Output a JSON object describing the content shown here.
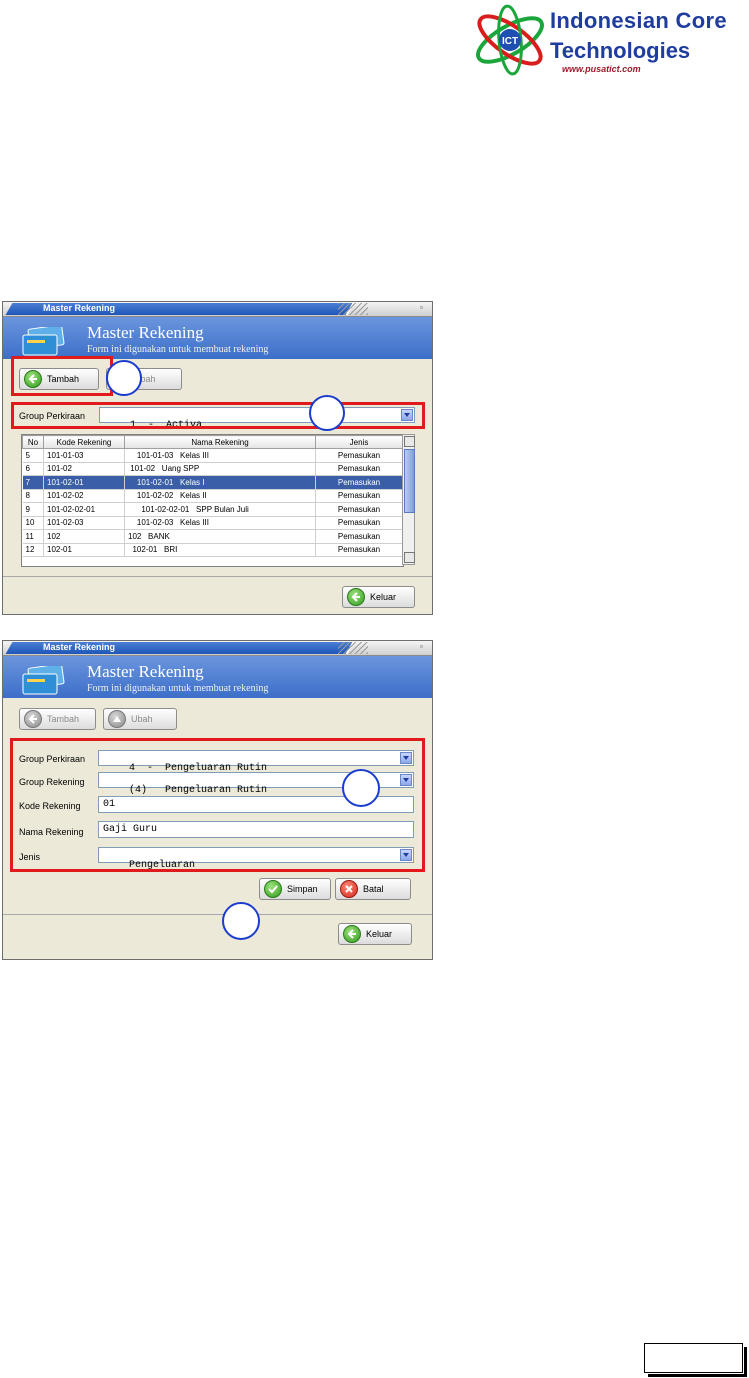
{
  "logo": {
    "line1": "Indonesian Core",
    "line2": "Technologies",
    "url": "www.pusatict.com",
    "mark": "ICT"
  },
  "window1": {
    "title": "Master Rekening",
    "header_title": "Master Rekening",
    "header_subtitle": "Form ini digunakan untuk membuat rekening",
    "buttons": {
      "tambah": "Tambah",
      "ubah": "Ubah",
      "keluar": "Keluar"
    },
    "group_label": "Group Perkiraan",
    "group_value": "1  -  Activa",
    "table": {
      "headers": [
        "No",
        "Kode Rekening",
        "Nama Rekening",
        "Jenis"
      ],
      "rows": [
        [
          "5",
          "101-01-03",
          "    101-01-03   Kelas III",
          "Pemasukan"
        ],
        [
          "6",
          "101-02",
          " 101-02   Uang SPP",
          "Pemasukan"
        ],
        [
          "7",
          "101-02-01",
          "    101-02-01   Kelas I",
          "Pemasukan"
        ],
        [
          "8",
          "101-02-02",
          "    101-02-02   Kelas II",
          "Pemasukan"
        ],
        [
          "9",
          "101-02-02-01",
          "      101-02-02-01   SPP Bulan Juli",
          "Pemasukan"
        ],
        [
          "10",
          "101-02-03",
          "    101-02-03   Kelas III",
          "Pemasukan"
        ],
        [
          "11",
          "102",
          "102   BANK",
          "Pemasukan"
        ],
        [
          "12",
          "102-01",
          "  102-01   BRI",
          "Pemasukan"
        ]
      ],
      "selected_index": 2
    }
  },
  "window2": {
    "title": "Master Rekening",
    "header_title": "Master Rekening",
    "header_subtitle": "Form ini digunakan untuk membuat rekening",
    "buttons": {
      "tambah": "Tambah",
      "ubah": "Ubah",
      "simpan": "Simpan",
      "batal": "Batal",
      "keluar": "Keluar"
    },
    "fields": {
      "group_perkiraan_label": "Group Perkiraan",
      "group_perkiraan_value": "4  -  Pengeluaran Rutin",
      "group_rekening_label": "Group Rekening",
      "group_rekening_value": "(4)   Pengeluaran Rutin",
      "kode_label": "Kode Rekening",
      "kode_value": "01",
      "nama_label": "Nama Rekening",
      "nama_value": "Gaji Guru",
      "jenis_label": "Jenis",
      "jenis_value": "Pengeluaran"
    }
  },
  "colors": {
    "header_blue": "#4a7fd0",
    "selection": "#3b5ea8",
    "highlight_red": "#e11b1b",
    "callout_blue": "#1a3ccf"
  }
}
